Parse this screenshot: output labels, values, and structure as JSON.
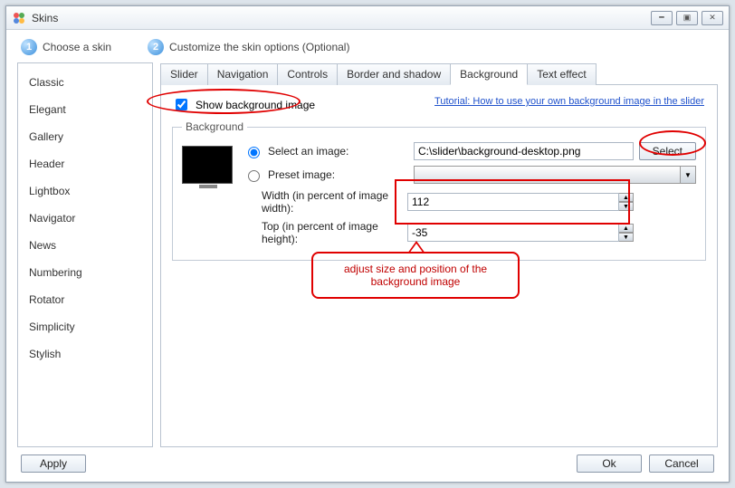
{
  "window": {
    "title": "Skins"
  },
  "steps": {
    "one_label": "Choose a skin",
    "two_label": "Customize the skin options (Optional)"
  },
  "sidebar": {
    "items": [
      "Classic",
      "Elegant",
      "Gallery",
      "Header",
      "Lightbox",
      "Navigator",
      "News",
      "Numbering",
      "Rotator",
      "Simplicity",
      "Stylish"
    ]
  },
  "tabs": [
    "Slider",
    "Navigation",
    "Controls",
    "Border and shadow",
    "Background",
    "Text effect"
  ],
  "active_tab_index": 4,
  "panel": {
    "show_bg_label": "Show background image",
    "show_bg_checked": true,
    "tutorial_link": "Tutorial: How to use your own background image in the slider",
    "group_title": "Background",
    "select_image_label": "Select an image:",
    "preset_label": "Preset image:",
    "path_value": "C:\\slider\\background-desktop.png",
    "select_btn": "Select",
    "width_label": "Width (in percent of image width):",
    "top_label": "Top (in percent of image height):",
    "width_value": "112",
    "top_value": "-35",
    "radio_selected": "select"
  },
  "footer": {
    "apply": "Apply",
    "ok": "Ok",
    "cancel": "Cancel"
  },
  "annotation": {
    "callout_text": "adjust size and position of the background image"
  }
}
